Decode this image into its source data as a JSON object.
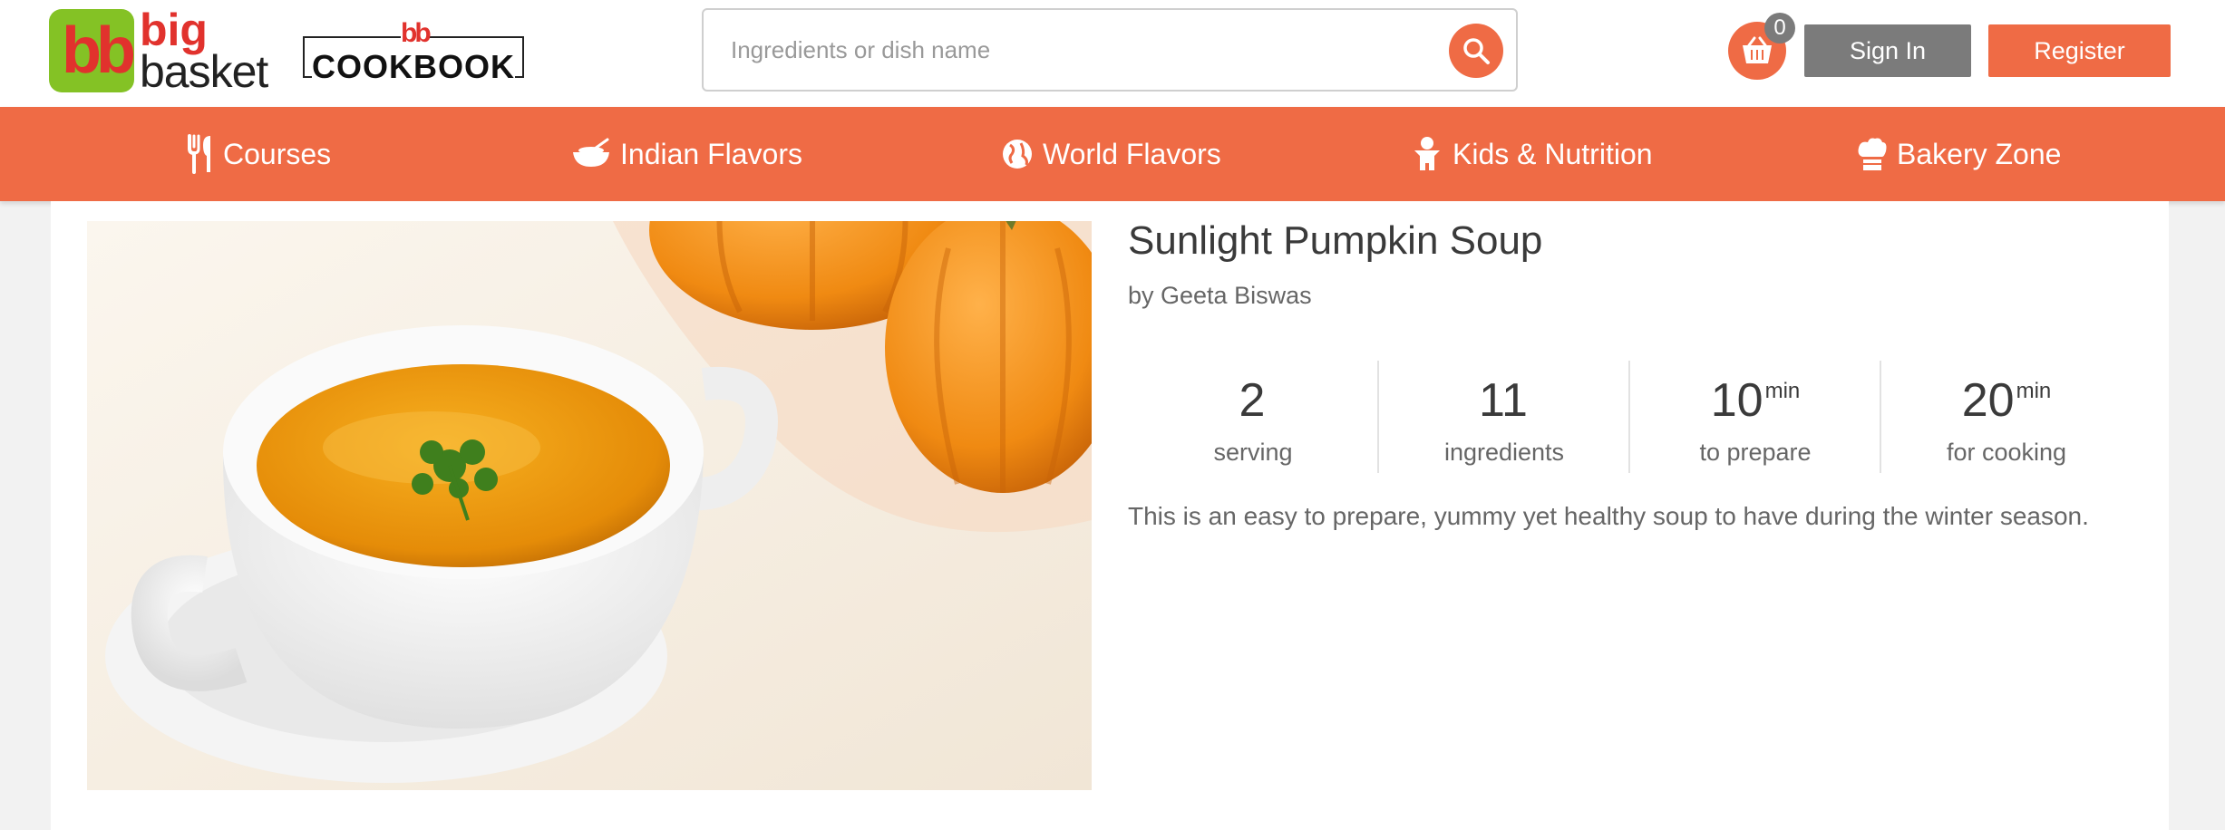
{
  "header": {
    "brand_top": "big",
    "brand_bottom": "basket",
    "brand_mark": "bb",
    "cookbook_mark": "bb",
    "cookbook_label": "COOKBOOK",
    "search_placeholder": "Ingredients or dish name",
    "search_value": "",
    "cart_count": "0",
    "signin_label": "Sign In",
    "register_label": "Register",
    "accent_color": "#ef6b45"
  },
  "nav": {
    "items": [
      {
        "label": "Courses",
        "icon": "fork-knife-icon"
      },
      {
        "label": "Indian Flavors",
        "icon": "bowl-icon"
      },
      {
        "label": "World Flavors",
        "icon": "globe-icon"
      },
      {
        "label": "Kids & Nutrition",
        "icon": "child-icon"
      },
      {
        "label": "Bakery Zone",
        "icon": "chef-hat-icon"
      }
    ]
  },
  "recipe": {
    "title": "Sunlight Pumpkin Soup",
    "author": "by Geeta Biswas",
    "stats": [
      {
        "value": "2",
        "unit": "",
        "label": "serving"
      },
      {
        "value": "11",
        "unit": "",
        "label": "ingredients"
      },
      {
        "value": "10",
        "unit": "min",
        "label": "to prepare"
      },
      {
        "value": "20",
        "unit": "min",
        "label": "for cooking"
      }
    ],
    "description": "This is an easy to prepare, yummy yet healthy soup to have during the winter season."
  }
}
